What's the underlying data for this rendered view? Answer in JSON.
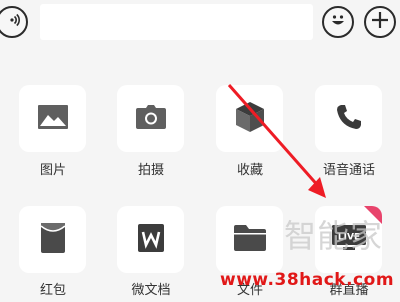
{
  "input": {
    "value": "",
    "placeholder": ""
  },
  "icons": {
    "voice": "voice-input-icon",
    "emoji": "emoji-icon",
    "plus": "plus-icon"
  },
  "panel": {
    "items": [
      {
        "label": "图片",
        "icon": "image-icon"
      },
      {
        "label": "拍摄",
        "icon": "camera-icon"
      },
      {
        "label": "收藏",
        "icon": "favorites-cube-icon"
      },
      {
        "label": "语音通话",
        "icon": "phone-icon"
      },
      {
        "label": "红包",
        "icon": "red-packet-icon"
      },
      {
        "label": "微文档",
        "icon": "doc-w-icon"
      },
      {
        "label": "文件",
        "icon": "folder-icon"
      },
      {
        "label": "群直播",
        "icon": "live-icon",
        "badge_text": "LIVE"
      }
    ]
  },
  "watermark": {
    "text": "智能家",
    "url": "www.38hack.com"
  },
  "colors": {
    "annotation_arrow": "#ee1c25",
    "badge": "#e8446c",
    "url_text": "#e11818"
  }
}
